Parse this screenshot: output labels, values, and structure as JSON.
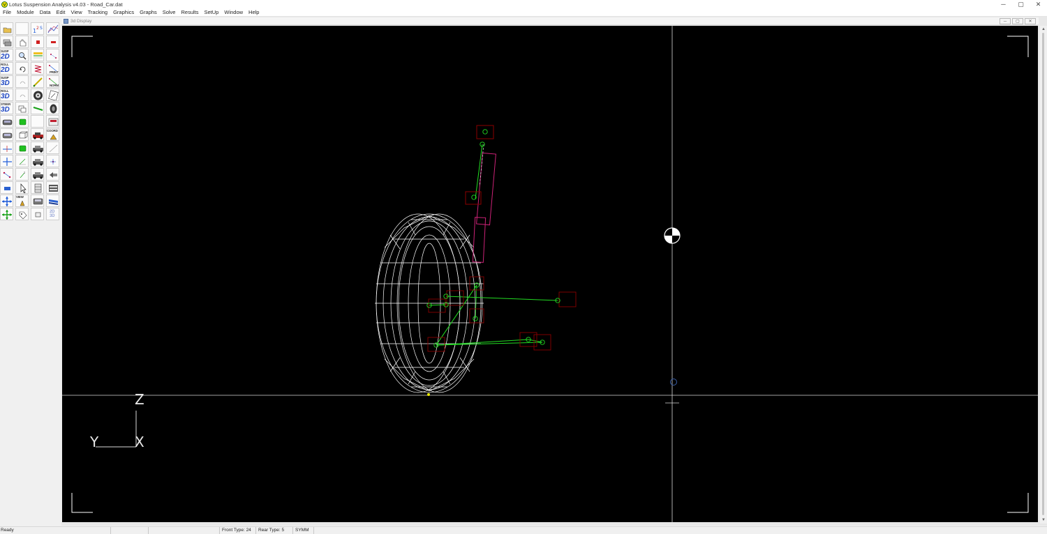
{
  "window": {
    "title": "Lotus Suspension Analysis v4.03 - Road_Car.dat",
    "minimize": "─",
    "maximize": "▢",
    "close": "✕"
  },
  "menu": [
    "File",
    "Module",
    "Data",
    "Edit",
    "View",
    "Tracking",
    "Graphics",
    "Graphs",
    "Solve",
    "Results",
    "SetUp",
    "Window",
    "Help"
  ],
  "toolbox": {
    "labels": {
      "susp20": {
        "tl": "SUSP",
        "big": "2D"
      },
      "roll20": {
        "tl": "ROLL",
        "big": "2D"
      },
      "susp30": {
        "tl": "SUSP",
        "big": "3D"
      },
      "roll30": {
        "tl": "ROLL",
        "big": "3D"
      },
      "steer30": {
        "tl": "STEER",
        "big": "3D"
      },
      "num12": "1 2",
      "num5": "5",
      "coord": "COORD",
      "view": "VIEW",
      "print": "PRINT",
      "norm": "NORM",
      "dim2030": "2D 3D"
    }
  },
  "document": {
    "title": "3d Display",
    "colors": {
      "background": "#000000",
      "tyre": "#ffffff",
      "links": "#22dd22",
      "hardpoint_box": "#8b0000",
      "damper": "#cc2277"
    },
    "axes": {
      "z": "Z",
      "y": "Y",
      "x": "X"
    }
  },
  "status": {
    "ready": "Ready",
    "front_type": "Front Type: 24",
    "rear_type": "Rear Type: 5",
    "symm": "SYMM"
  }
}
